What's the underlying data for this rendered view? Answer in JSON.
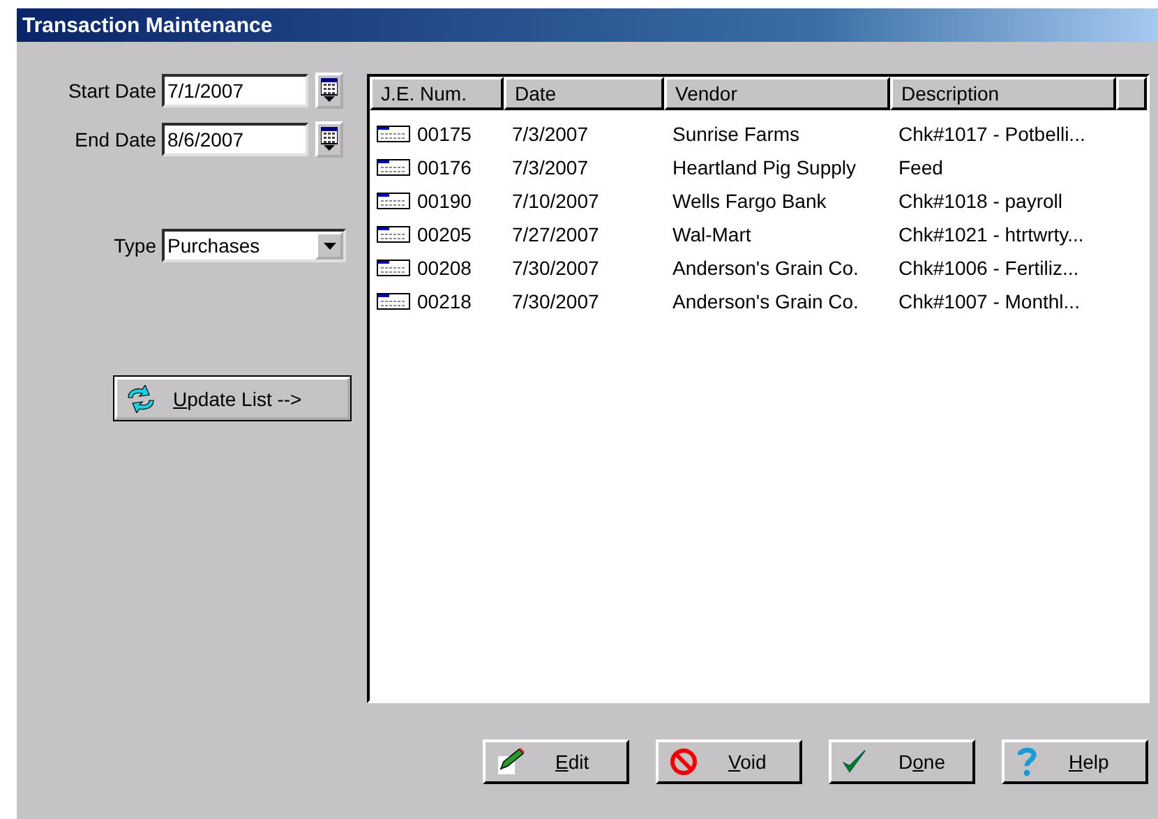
{
  "window": {
    "title": "Transaction Maintenance"
  },
  "filters": {
    "start_date": {
      "label": "Start Date",
      "value": "7/1/2007"
    },
    "end_date": {
      "label": "End Date",
      "value": "8/6/2007"
    },
    "type": {
      "label": "Type",
      "value": "Purchases"
    }
  },
  "update_button": {
    "access_key": "U",
    "label_rest": "pdate List -->"
  },
  "table": {
    "columns": [
      "J.E. Num.",
      "Date",
      "Vendor",
      "Description"
    ],
    "rows": [
      {
        "num": "00175",
        "date": "7/3/2007",
        "vendor": "Sunrise Farms",
        "description": "Chk#1017 - Potbelli..."
      },
      {
        "num": "00176",
        "date": "7/3/2007",
        "vendor": "Heartland Pig Supply",
        "description": "Feed"
      },
      {
        "num": "00190",
        "date": "7/10/2007",
        "vendor": "Wells Fargo Bank",
        "description": "Chk#1018 - payroll"
      },
      {
        "num": "00205",
        "date": "7/27/2007",
        "vendor": "Wal-Mart",
        "description": "Chk#1021 - htrtwrty..."
      },
      {
        "num": "00208",
        "date": "7/30/2007",
        "vendor": "Anderson's Grain Co.",
        "description": "Chk#1006 - Fertiliz..."
      },
      {
        "num": "00218",
        "date": "7/30/2007",
        "vendor": "Anderson's Grain Co.",
        "description": "Chk#1007 - Monthl..."
      }
    ]
  },
  "buttons": [
    {
      "kind": "edit",
      "access_key": "E",
      "label_rest": "dit"
    },
    {
      "kind": "void",
      "access_key": "V",
      "label_rest": "oid"
    },
    {
      "kind": "done",
      "label_start": "D",
      "access_key": "o",
      "label_rest": "ne"
    },
    {
      "kind": "help",
      "access_key": "H",
      "label_rest": "elp"
    }
  ]
}
